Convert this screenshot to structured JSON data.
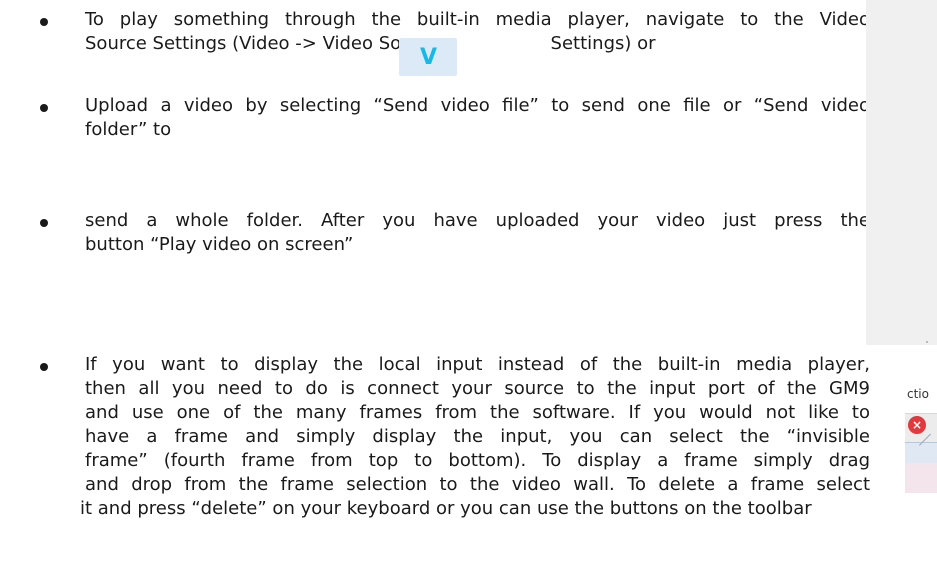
{
  "bullets": [
    {
      "lines": [
        "To play something through the built-in media player, navigate to the Video",
        "Source Settings (Video -> Video Source",
        "Settings) or"
      ]
    },
    {
      "lines": [
        "Upload a video by selecting “Send video file” to send one file or “Send video",
        "folder” to"
      ]
    },
    {
      "lines": [
        "send a whole folder. After you have uploaded your video just press the",
        "button “Play video on screen”"
      ]
    },
    {
      "lines": [
        "If you want to display the local input instead of the built-in media player,",
        "then all you need to do is connect your source to the input port of the GM9",
        "and use one of the many frames from the software. If you would not like to",
        "have a frame and simply display the input, you can select the “invisible",
        "frame” (fourth frame from top to bottom). To display a frame simply drag",
        "and drop from the frame selection to the video wall. To delete a frame select",
        "it and press “delete” on your keyboard or you can use the buttons on the toolbar"
      ]
    }
  ],
  "video_source_icon": {
    "glyph": "V",
    "icon_name": "video-source-icon",
    "color": "#18b8e8",
    "background": "#dceaf8"
  },
  "mini_screenshot": {
    "text": "ctio",
    "close_icon_glyph": "×",
    "icon_name": "close-icon"
  }
}
